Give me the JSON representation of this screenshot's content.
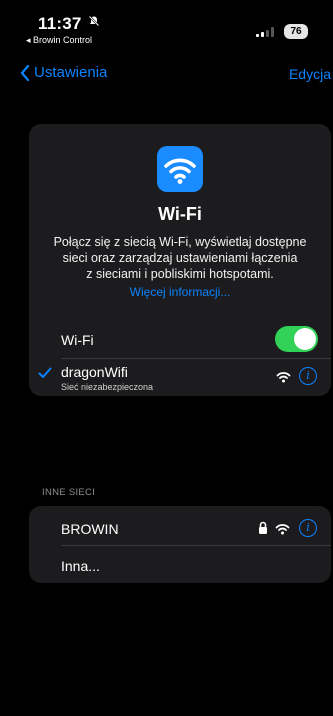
{
  "status_bar": {
    "time": "11:37",
    "back_app": "◂ Browin Control",
    "battery": "76"
  },
  "nav": {
    "back_label": "Ustawienia",
    "edit_label": "Edycja"
  },
  "wifi_card": {
    "title": "Wi-Fi",
    "description_lines": [
      "Połącz się z siecią Wi-Fi, wyświetlaj dostępne",
      "sieci oraz zarządzaj ustawieniami łączenia",
      "z sieciami i pobliskimi hotspotami."
    ],
    "link": "Więcej informacji...",
    "toggle_label": "Wi-Fi",
    "toggle_on": true,
    "connected_network": {
      "name": "dragonWifi",
      "subtitle": "Sieć niezabezpieczona"
    }
  },
  "other_networks": {
    "header": "INNE SIECI",
    "items": [
      {
        "name": "BROWIN",
        "secured": true
      },
      {
        "name": "Inna..."
      }
    ]
  },
  "colors": {
    "accent": "#0a84ff",
    "toggle_on": "#32d158",
    "card_bg": "#1c1c1e"
  }
}
